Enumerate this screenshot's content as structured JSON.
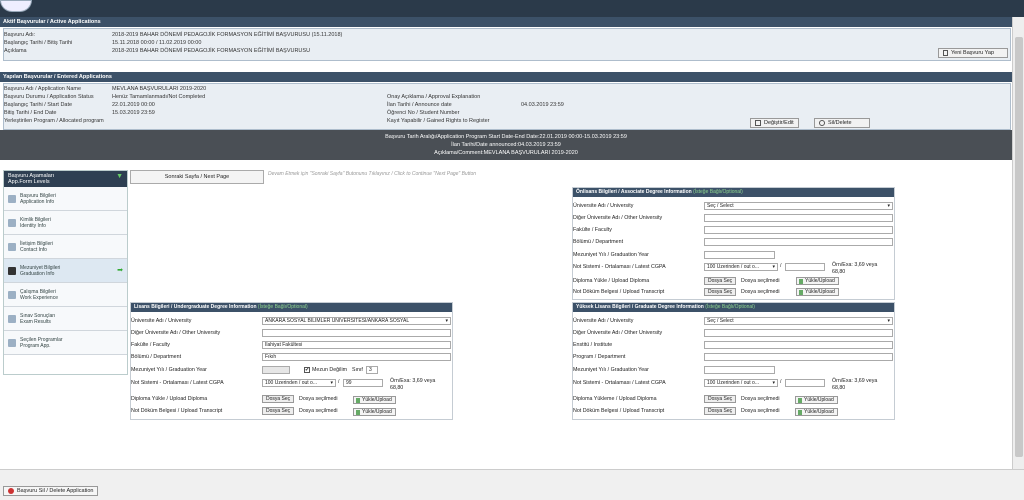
{
  "active_apps": {
    "header": "Aktif Başvurular / Active Applications",
    "rows": [
      {
        "label": "Başvuru Adı:",
        "value": "2018-2019 BAHAR DÖNEMİ PEDAGOJİK FORMASYON EĞİTİMİ BAŞVURUSU (15.11.2018)"
      },
      {
        "label": "Başlangıç Tarihi / Bitiş Tarihi",
        "value": "15.11.2018 00:00 / 11.02.2019 00:00"
      },
      {
        "label": "Açıklama",
        "value": "2018-2019 BAHAR DÖNEMİ PEDAGOJİK FORMASYON EĞİTİMİ BAŞVURUSU"
      }
    ],
    "new_button": "Yeni Başvuru Yap"
  },
  "entered_apps": {
    "header": "Yapılan Başvurular / Entered Applications",
    "left": [
      {
        "label": "Başvuru Adı / Application Name",
        "value": "MEVLANA BAŞVURULARI 2019-2020"
      },
      {
        "label": "Başvuru Durumu / Application Status",
        "value": "Henüz Tamamlanmadı/Not Completed"
      },
      {
        "label": "Başlangıç Tarihi / Start Date",
        "value": "22.01.2019 00:00"
      },
      {
        "label": "Bitiş Tarihi / End Date",
        "value": "15.03.2019 23:59"
      },
      {
        "label": "Yerleştirilen Program / Allocated program",
        "value": ""
      }
    ],
    "right": [
      {
        "label": "Onay Açıklama / Approval Explanation",
        "value": ""
      },
      {
        "label": "İlan Tarihi / Announce date",
        "value": "04.03.2019 23:59"
      },
      {
        "label": "Öğrenci No / Student Number",
        "value": ""
      },
      {
        "label": "Kayıt Yapabilir / Gained Rights to Register",
        "value": ""
      }
    ],
    "edit_button": "Değiştir/Edit",
    "delete_button": "Sil/Delete"
  },
  "band": {
    "line1": "Başvuru Tarih Aralığı/Application Program Start Date-End Date:22.01.2019 00:00-15.03.2019 23:59",
    "line2": "İlan Tarihi/Date announced:04.03.2019 23:59",
    "line3": "Açıklama/Comment:MEVLANA BAŞVURULARI 2019-2020"
  },
  "sidebar": {
    "title": "Başvuru Aşamaları\nApp.Form Levels",
    "items": [
      {
        "label": "Başvuru Bilgileri\nApplication Info"
      },
      {
        "label": "Kimlik Bilgileri\nIdentity Info"
      },
      {
        "label": "İletişim Bilgileri\nContact Info"
      },
      {
        "label": "Mezuniyet Bilgileri\nGraduation Info"
      },
      {
        "label": "Çalışma Bilgileri\nWork Experience"
      },
      {
        "label": "Sınav Sonuçları\nExam Results"
      },
      {
        "label": "Seçilen Programlar\nProgram App."
      }
    ]
  },
  "next_page": "Sonraki Sayfa / Next Page",
  "hint": "Devam Etmek için \"Sonraki Sayfa\" Butonunu Tıklayınız / Click to Continue \"Next Page\" Button",
  "associate": {
    "title": "Önlisans Bilgileri / Associate Degree Information",
    "optional": "(İsteğe Bağlı/Optional)",
    "university": "Üniversite Adı / University",
    "university_value": "Seç / Select",
    "other_university": "Diğer Üniversite Adı / Other University",
    "faculty": "Fakülte / Faculty",
    "department": "Bölümü / Department",
    "grad_year": "Mezuniyet Yılı / Graduation Year",
    "gpa": "Not Sistemi - Ortalaması / Latest CGPA",
    "gpa_select": "100 Üzerinden / out o...",
    "gpa_sep": "/",
    "gpa_example": "Örn/Exa: 3,69 veya",
    "gpa_example2": "68,80",
    "diploma": "Diploma Yükle / Upload Diploma",
    "transcript": "Not Döküm Belgesi / Upload Transcript",
    "choose": "Dosya Seç",
    "no_file": "Dosya seçilmedi",
    "upload": "Yükle/Upload"
  },
  "undergrad": {
    "title": "Lisans Bilgileri / Undergraduate Degree Information",
    "optional": "(İsteğe Bağlı/Optional)",
    "university": "Üniversite Adı / University",
    "university_value": "ANKARA SOSYAL BİLİMLER ÜNİVERSİTESİ/ANKARA SOSYAL",
    "other_university": "Diğer Üniversite Adı / Other University",
    "faculty": "Fakülte / Faculty",
    "faculty_value": "İlahiyat Fakültesi",
    "department": "Bölümü / Department",
    "department_value": "Fıkıh",
    "grad_year": "Mezuniyet Yılı / Graduation Year",
    "not_graduated": "Mezun Değilim",
    "class_label": "Sınıf",
    "class_value": "3",
    "gpa": "Not Sistemi - Ortalaması / Latest CGPA",
    "gpa_select": "100 Üzerinden / out o...",
    "gpa_sep": "/",
    "gpa_value": "99",
    "gpa_example": "Örn/Exa: 3,69 veya",
    "gpa_example2": "68,80",
    "diploma": "Diploma Yükle / Upload Diploma",
    "transcript": "Not Döküm Belgesi / Upload Transcript",
    "choose": "Dosya Seç",
    "no_file": "Dosya seçilmedi",
    "upload": "Yükle/Upload"
  },
  "graduate": {
    "title": "Yüksek Lisans Bilgileri / Graduate Degree Information",
    "optional": "(İsteğe Bağlı/Optional)",
    "university": "Üniversite Adı / University",
    "university_value": "Seç / Select",
    "other_university": "Diğer Üniversite Adı / Other University",
    "institute": "Enstitü / Institute",
    "program": "Program / Department",
    "grad_year": "Mezuniyet Yılı / Graduation Year",
    "gpa": "Not Sistemi - Ortalaması / Latest CGPA",
    "gpa_select": "100 Üzerinden / out o...",
    "gpa_sep": "/",
    "gpa_example": "Örn/Exa: 3,69 veya",
    "gpa_example2": "68,80",
    "diploma": "Diploma Yükleme / Upload Diploma",
    "transcript": "Not Döküm Belgesi / Upload Transcript",
    "choose": "Dosya Seç",
    "no_file": "Dosya seçilmedi",
    "upload": "Yükle/Upload"
  },
  "footer": {
    "delete_application": "Başvuru Sil / Delete Application"
  }
}
